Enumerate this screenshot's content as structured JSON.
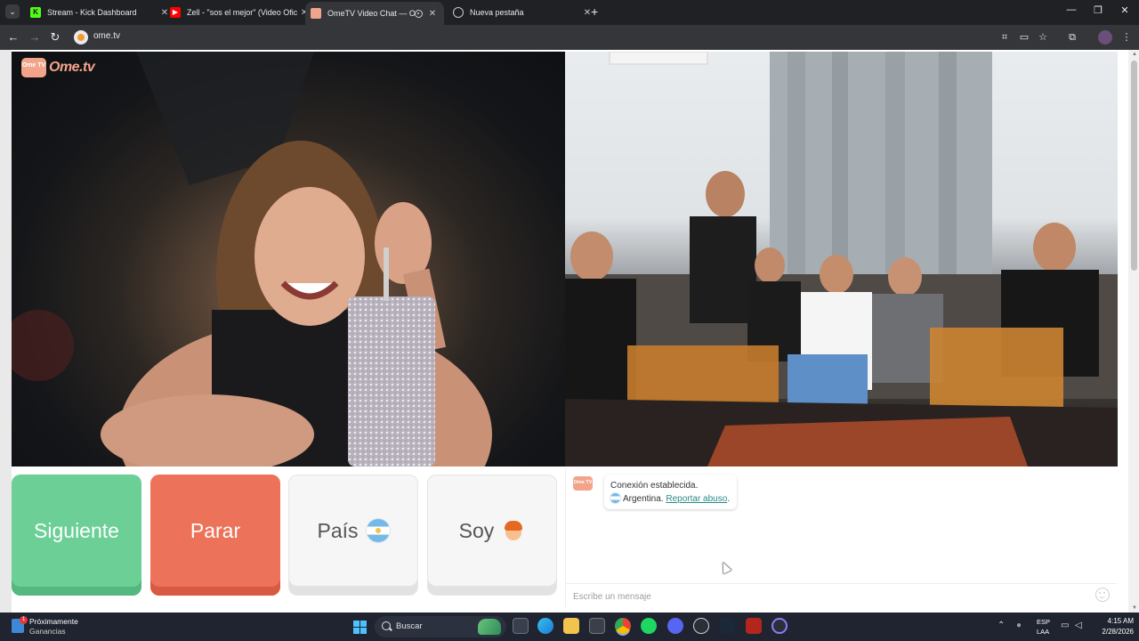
{
  "browser": {
    "tabs": [
      {
        "title": "Stream - Kick Dashboard",
        "favicon": "kick-icon",
        "active": false
      },
      {
        "title": "Zell - \"sos el mejor\" (Video Ofic",
        "favicon": "youtube-icon",
        "active": false
      },
      {
        "title": "OmeTV Video Chat — Ome",
        "favicon": "ometv-icon",
        "active": true
      },
      {
        "title": "Nueva pestaña",
        "favicon": "globe-icon",
        "active": false
      }
    ],
    "close_glyph": "✕",
    "newtab_glyph": "+",
    "url": "ome.tv",
    "colors": {
      "kick": "#53fc18",
      "youtube": "#ff0000",
      "ometv": "#f2a48a"
    }
  },
  "site": {
    "logo_badge": "Ome TV",
    "logo_word": "Ome.tv"
  },
  "controls": {
    "next_label": "Siguiente",
    "stop_label": "Parar",
    "country_label": "País",
    "gender_label": "Soy",
    "colors": {
      "next": "#6ccf96",
      "stop": "#ec725a"
    }
  },
  "chat": {
    "badge": "Ome TV",
    "status_line": "Conexión establecida.",
    "country_line": "Argentina.",
    "report_link": "Reportar abuso",
    "trailing_period": ".",
    "input_placeholder": "Escribe un mensaje"
  },
  "taskbar": {
    "widget_title": "Próximamente",
    "widget_subtitle": "Ganancias",
    "widget_badge": "1",
    "search_placeholder": "Buscar",
    "lang_top": "ESP",
    "lang_bottom": "LAA",
    "time": "4:15 AM",
    "date": "2/28/2026"
  }
}
